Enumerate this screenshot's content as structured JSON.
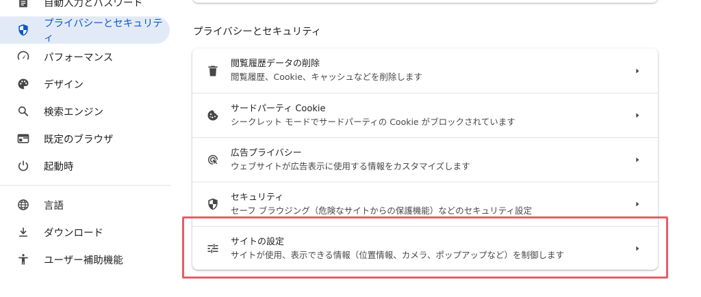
{
  "sidebar": {
    "items": [
      {
        "label": "自動入力とパスワード",
        "icon": "autofill-icon"
      },
      {
        "label": "プライバシーとセキュリティ",
        "icon": "shield-icon",
        "active": true
      },
      {
        "label": "パフォーマンス",
        "icon": "speedometer-icon"
      },
      {
        "label": "デザイン",
        "icon": "palette-icon"
      },
      {
        "label": "検索エンジン",
        "icon": "search-icon"
      },
      {
        "label": "既定のブラウザ",
        "icon": "browser-window-icon"
      },
      {
        "label": "起動時",
        "icon": "power-icon"
      },
      {
        "label": "言語",
        "icon": "globe-icon"
      },
      {
        "label": "ダウンロード",
        "icon": "download-icon"
      },
      {
        "label": "ユーザー補助機能",
        "icon": "accessibility-icon"
      }
    ]
  },
  "main": {
    "section_title": "プライバシーとセキュリティ",
    "rows": [
      {
        "title": "閲覧履歴データの削除",
        "subtitle": "閲覧履歴、Cookie、キャッシュなどを削除します",
        "icon": "trash-icon"
      },
      {
        "title": "サードパーティ Cookie",
        "subtitle": "シークレット モードでサードパーティの Cookie がブロックされています",
        "icon": "cookie-icon"
      },
      {
        "title": "広告プライバシー",
        "subtitle": "ウェブサイトが広告表示に使用する情報をカスタマイズします",
        "icon": "ad-privacy-icon"
      },
      {
        "title": "セキュリティ",
        "subtitle": "セーフ ブラウジング（危険なサイトからの保護機能）などのセキュリティ設定",
        "icon": "security-shield-icon"
      },
      {
        "title": "サイトの設定",
        "subtitle": "サイトが使用、表示できる情報（位置情報、カメラ、ポップアップなど）を制御します",
        "icon": "tune-icon"
      }
    ]
  },
  "colors": {
    "accent": "#0b57d0",
    "active_bg": "#e3eaf7",
    "highlight": "#e85c66"
  }
}
